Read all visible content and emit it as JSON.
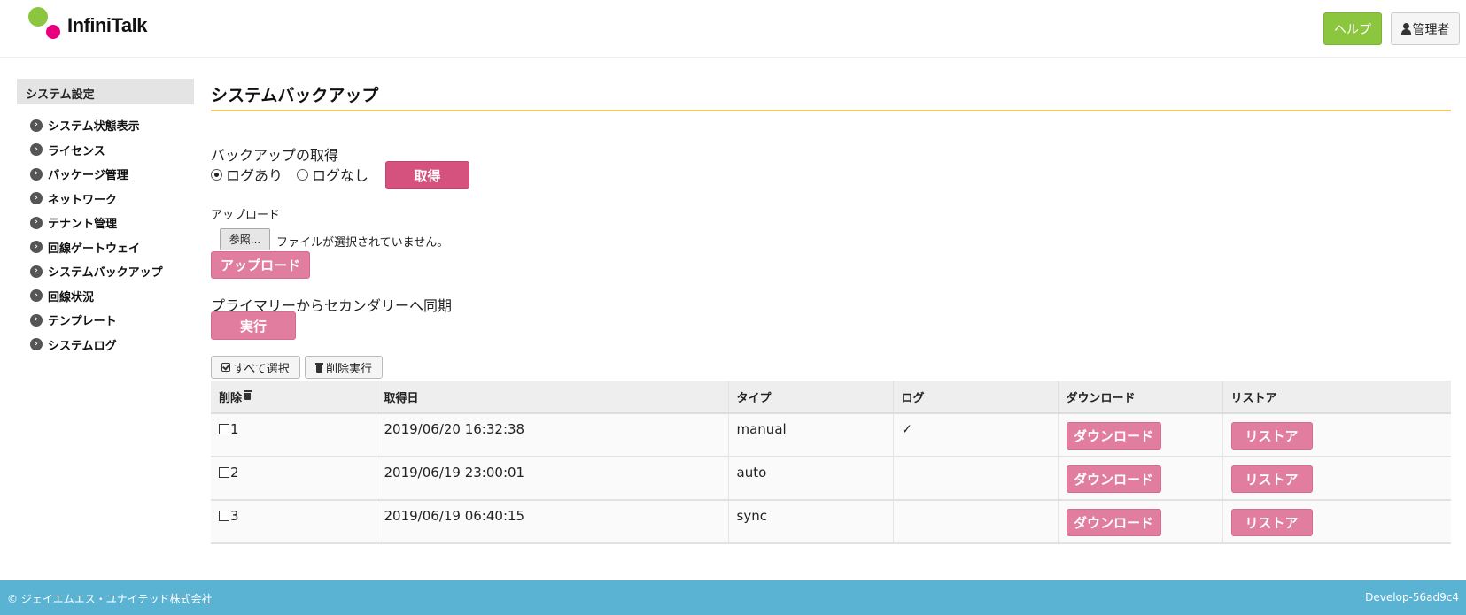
{
  "header": {
    "logo_text": "InfiniTalk",
    "help_label": "ヘルプ",
    "admin_label": "管理者"
  },
  "sidebar": {
    "heading": "システム設定",
    "items": [
      {
        "label": "システム状態表示"
      },
      {
        "label": "ライセンス"
      },
      {
        "label": "パッケージ管理"
      },
      {
        "label": "ネットワーク"
      },
      {
        "label": "テナント管理"
      },
      {
        "label": "回線ゲートウェイ"
      },
      {
        "label": "システムバックアップ"
      },
      {
        "label": "回線状況"
      },
      {
        "label": "テンプレート"
      },
      {
        "label": "システムログ"
      }
    ]
  },
  "main": {
    "title": "システムバックアップ",
    "backup": {
      "label": "バックアップの取得",
      "option_with_log": "ログあり",
      "option_without_log": "ログなし",
      "selected": "ログあり",
      "get_button": "取得"
    },
    "upload": {
      "label": "アップロード",
      "browse_button": "参照...",
      "file_status": "ファイルが選択されていません。",
      "upload_button": "アップロード"
    },
    "sync": {
      "label": "プライマリーからセカンダリーへ同期",
      "run_button": "実行"
    },
    "toolbar": {
      "select_all": "すべて選択",
      "delete_exec": "削除実行"
    },
    "table": {
      "headers": {
        "delete": "削除",
        "date": "取得日",
        "type": "タイプ",
        "log": "ログ",
        "download": "ダウンロード",
        "restore": "リストア"
      },
      "rows": [
        {
          "id": "1",
          "date": "2019/06/20 16:32:38",
          "type": "manual",
          "log": "✓",
          "download": "ダウンロード",
          "restore": "リストア"
        },
        {
          "id": "2",
          "date": "2019/06/19 23:00:01",
          "type": "auto",
          "log": "",
          "download": "ダウンロード",
          "restore": "リストア"
        },
        {
          "id": "3",
          "date": "2019/06/19 06:40:15",
          "type": "sync",
          "log": "",
          "download": "ダウンロード",
          "restore": "リストア"
        }
      ]
    }
  },
  "footer": {
    "copyright": "© ジェイエムエス・ユナイテッド株式会社",
    "version": "Develop-56ad9c4"
  },
  "colors": {
    "accent_green": "#8cc63f",
    "accent_pink": "#d5527e",
    "button_pink": "#e17ea0",
    "title_rule": "#f0c85a",
    "footer_blue": "#5bb3d3"
  }
}
